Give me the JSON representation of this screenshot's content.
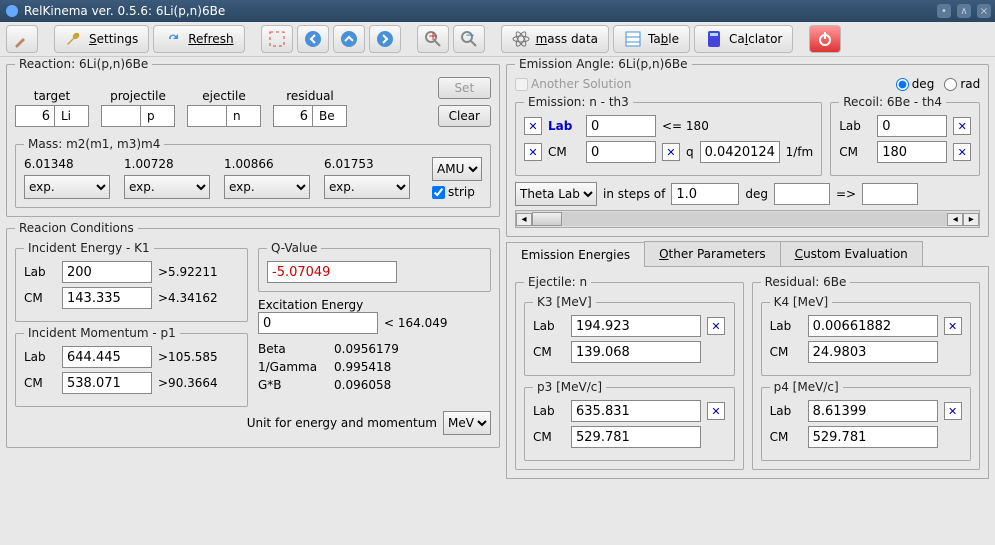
{
  "window": {
    "title": "RelKinema ver. 0.5.6: 6Li(p,n)6Be"
  },
  "toolbar": {
    "settings": "Settings",
    "refresh": "Refresh",
    "mass_data": "mass data",
    "table": "Table",
    "calculator": "Calclator"
  },
  "reaction": {
    "legend": "Reaction: 6Li(p,n)6Be",
    "headers": {
      "target": "target",
      "projectile": "projectile",
      "ejectile": "ejectile",
      "residual": "residual"
    },
    "target_n": "6",
    "target_s": "Li",
    "proj_n": "",
    "proj_s": "p",
    "ejec_n": "",
    "ejec_s": "n",
    "res_n": "6",
    "res_s": "Be",
    "set": "Set",
    "clear": "Clear"
  },
  "mass": {
    "legend": "Mass: m2(m1, m3)m4",
    "vals": [
      "6.01348",
      "1.00728",
      "1.00866",
      "6.01753"
    ],
    "src": "exp.",
    "unit": "AMU",
    "strip": "strip"
  },
  "reac_cond": {
    "legend": "Reacion Conditions",
    "incE": "Incident Energy - K1",
    "incP": "Incident Momentum - p1",
    "lab": "Lab",
    "cm": "CM",
    "k1_lab": "200",
    "k1_lab_gt": ">5.92211",
    "k1_cm": "143.335",
    "k1_cm_gt": ">4.34162",
    "p1_lab": "644.445",
    "p1_lab_gt": ">105.585",
    "p1_cm": "538.071",
    "p1_cm_gt": ">90.3664",
    "qv": "Q-Value",
    "qv_val": "-5.07049",
    "exE": "Excitation Energy",
    "exE_val": "0",
    "exE_lim": "< 164.049",
    "beta": "Beta",
    "beta_v": "0.0956179",
    "ig": "1/Gamma",
    "ig_v": "0.995418",
    "gb": "G*B",
    "gb_v": "0.096058",
    "unit_lbl": "Unit for energy and momentum",
    "unit": "MeV"
  },
  "emission": {
    "legend": "Emission Angle: 6Li(p,n)6Be",
    "another": "Another Solution",
    "deg": "deg",
    "rad": "rad",
    "em_legend": "Emission: n - th3",
    "rec_legend": "Recoil: 6Be - th4",
    "lab": "Lab",
    "cm": "CM",
    "em_lab": "0",
    "em_lim": "<= 180",
    "em_cm": "0",
    "q": "q",
    "q_val": "0.0420124",
    "q_unit": "1/fm",
    "rec_lab": "0",
    "rec_cm": "180",
    "theta": "Theta Lab",
    "steps": "in steps of",
    "steps_v": "1.0",
    "steps_u": "deg",
    "arrow": "=>"
  },
  "tabs": {
    "ee": "Emission Energies",
    "op": "Other Parameters",
    "ce": "Custom Evaluation"
  },
  "energies": {
    "ej_legend": "Ejectile: n",
    "res_legend": "Residual: 6Be",
    "k3": "K3 [MeV]",
    "k4": "K4 [MeV]",
    "p3": "p3 [MeV/c]",
    "p4": "p4 [MeV/c]",
    "lab": "Lab",
    "cm": "CM",
    "k3_lab": "194.923",
    "k3_cm": "139.068",
    "p3_lab": "635.831",
    "p3_cm": "529.781",
    "k4_lab": "0.00661882",
    "k4_cm": "24.9803",
    "p4_lab": "8.61399",
    "p4_cm": "529.781"
  }
}
